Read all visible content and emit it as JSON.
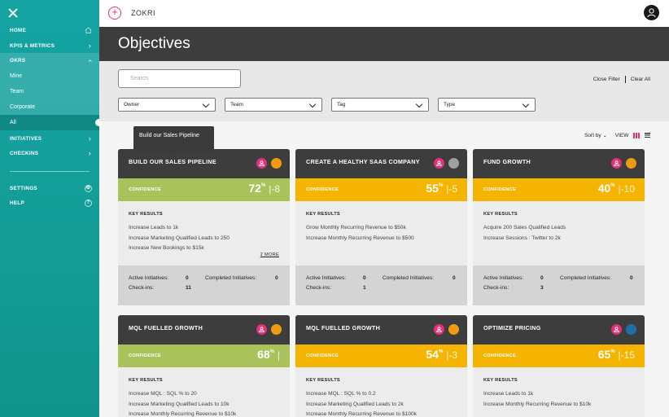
{
  "sidebar": {
    "items": [
      {
        "label": "HOME"
      },
      {
        "label": "KPIs & METRICS"
      },
      {
        "label": "OKRs"
      },
      {
        "label": "Mine"
      },
      {
        "label": "Team"
      },
      {
        "label": "Corporate"
      },
      {
        "label": "All"
      },
      {
        "label": "INITIATIVES"
      },
      {
        "label": "CHECKINS"
      },
      {
        "label": "SETTINGS"
      },
      {
        "label": "HELP"
      }
    ]
  },
  "topbar": {
    "brand": "ZOKRI"
  },
  "header": {
    "title": "Objectives"
  },
  "filters": {
    "search_placeholder": "Search",
    "close_filter": "Close Filter",
    "clear_all": "Clear All",
    "dropdowns": [
      {
        "label": "Owner"
      },
      {
        "label": "Team"
      },
      {
        "label": "Tag"
      },
      {
        "label": "Type"
      }
    ]
  },
  "sort": {
    "sort_by": "Sort by",
    "view": "VIEW"
  },
  "tooltip": {
    "text": "Build our Sales Pipeline"
  },
  "labels": {
    "confidence": "CONFIDENCE",
    "key_results": "KEY RESULTS",
    "active_initiatives": "Active Initiatives:",
    "completed_initiatives": "Completed Initiatives:",
    "checkins": "Check-ins:"
  },
  "colors": {
    "green": "#a9c25a",
    "yellow": "#f5b400",
    "orange": "#f09a13",
    "grey": "#a0a0a0",
    "blue": "#1e6fa8",
    "accent": "#e0327a"
  },
  "cards": [
    {
      "title": "BUILD OUR SALES PIPELINE",
      "status": "orange",
      "band": "green",
      "score": "72",
      "pct": "%",
      "delta": "|-8",
      "krs": [
        "Increase Leads to 1k",
        "Increase Marketing Qualified Leads to 250",
        "Increase New Bookings to $15k"
      ],
      "more": "2 MORE",
      "active": "0",
      "completed": "0",
      "checkins": "11"
    },
    {
      "title": "CREATE A HEALTHY SAAS COMPANY",
      "status": "grey",
      "band": "yellow",
      "score": "55",
      "pct": "%",
      "delta": "|-5",
      "krs": [
        "Grow Monthly Recurring Revenue to $50k",
        "Increase Monthly Recurring Revenue to $500"
      ],
      "more": "",
      "active": "0",
      "completed": "0",
      "checkins": "1"
    },
    {
      "title": "FUND GROWTH",
      "status": "orange",
      "band": "yellow",
      "score": "40",
      "pct": "%",
      "delta": "|-10",
      "krs": [
        "Acquire 200 Sales Qualified Leads",
        "Increase Sessions : Twitter to 2k"
      ],
      "more": "",
      "active": "0",
      "completed": "0",
      "checkins": "3"
    },
    {
      "title": "MQL FUELLED GROWTH",
      "status": "orange",
      "band": "green",
      "score": "68",
      "pct": "%",
      "delta": "|",
      "krs": [
        "Increase MQL : SQL % to 20",
        "Increase Marketing Qualified Leads to 10k",
        "Increase Monthly Recurring Revenue to $10k"
      ],
      "more": ""
    },
    {
      "title": "MQL FUELLED GROWTH",
      "status": "orange",
      "band": "yellow",
      "score": "54",
      "pct": "%",
      "delta": "|-3",
      "krs": [
        "Increase MQL : SQL % to 0.2",
        "Increase Marketing Qualified Leads to 2k",
        "Increase Monthly Recurring Revenue to $100k"
      ],
      "more": ""
    },
    {
      "title": "OPTIMIZE PRICING",
      "status": "blue",
      "band": "yellow",
      "score": "65",
      "pct": "%",
      "delta": "|-15",
      "krs": [
        "Increase Leads to 1k",
        "Increase Monthly Recurring Revenue to $10k"
      ],
      "more": ""
    }
  ]
}
